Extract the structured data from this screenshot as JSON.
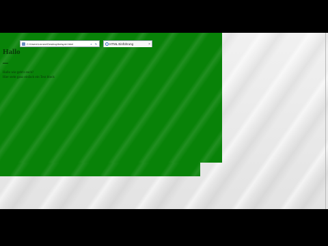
{
  "browser": {
    "address": "C:\\Users\\Lernen\\Desktop\\beispiel.html",
    "tab_title": "HTML Einführung",
    "tab_close": "×"
  },
  "page": {
    "heading": "Hallo",
    "line1": "Hallo wie geht's euch?",
    "line2": "Hier steht ganz einfach ein Text block"
  },
  "colors": {
    "page_background": "#088208",
    "desktop": "#e6e6e6",
    "letterbox": "#000000"
  },
  "icons": {
    "address": "page-icon",
    "back": "search-icon",
    "refresh": "refresh-icon",
    "tab": "ie-icon"
  }
}
